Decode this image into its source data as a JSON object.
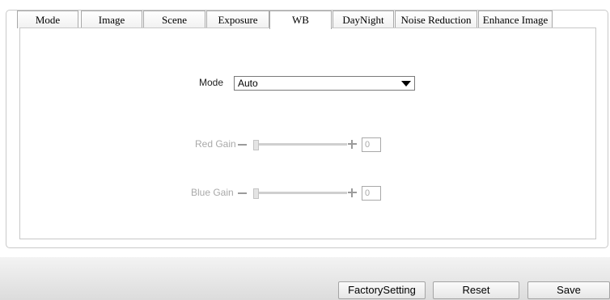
{
  "tabs": [
    {
      "label": "Mode"
    },
    {
      "label": "Image"
    },
    {
      "label": "Scene"
    },
    {
      "label": "Exposure"
    },
    {
      "label": "WB",
      "active": true
    },
    {
      "label": "DayNight"
    },
    {
      "label": "Noise Reduction"
    },
    {
      "label": "Enhance Image"
    }
  ],
  "wb": {
    "mode_label": "Mode",
    "mode_value": "Auto",
    "red_gain_label": "Red Gain",
    "red_gain_value": "0",
    "blue_gain_label": "Blue Gain",
    "blue_gain_value": "0"
  },
  "buttons": {
    "factory": "FactorySetting",
    "reset": "Reset",
    "save": "Save"
  }
}
